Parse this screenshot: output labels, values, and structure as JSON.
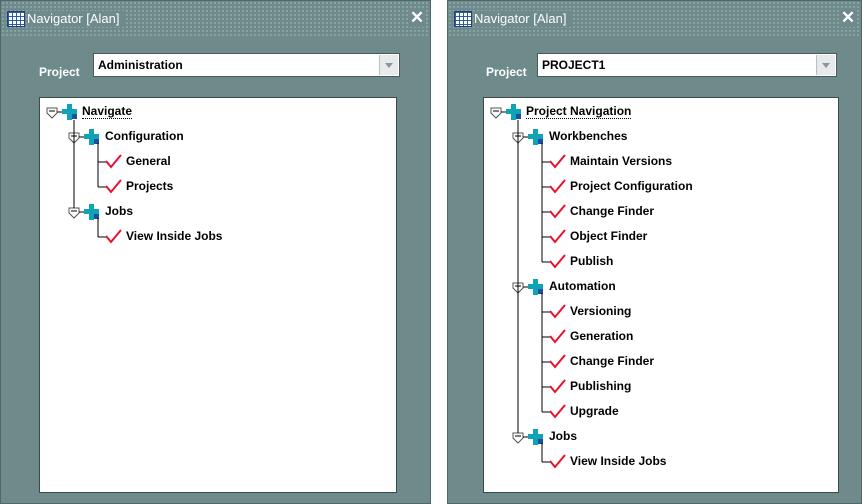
{
  "windows": [
    {
      "title": "Navigator [Alan]",
      "project_label": "Project",
      "project_value": "Administration",
      "tree": {
        "root": "Navigate",
        "nodes": [
          {
            "label": "Configuration",
            "children": [
              "General",
              "Projects"
            ]
          },
          {
            "label": "Jobs",
            "children": [
              "View Inside Jobs"
            ]
          }
        ]
      }
    },
    {
      "title": "Navigator [Alan]",
      "project_label": "Project",
      "project_value": "PROJECT1",
      "tree": {
        "root": "Project Navigation",
        "nodes": [
          {
            "label": "Workbenches",
            "children": [
              "Maintain Versions",
              "Project Configuration",
              "Change Finder",
              "Object Finder",
              "Publish"
            ]
          },
          {
            "label": "Automation",
            "children": [
              "Versioning",
              "Generation",
              "Change Finder",
              "Publishing",
              "Upgrade"
            ]
          },
          {
            "label": "Jobs",
            "children": [
              "View Inside Jobs"
            ]
          }
        ]
      }
    }
  ],
  "colors": {
    "window_bg": "#6f8a8b",
    "checkmark": "#e8102a",
    "folder_icon": "#0fa3b8"
  },
  "icons": {
    "app": "grid-table-icon",
    "close": "close-icon",
    "expanded": "collapse-node-icon",
    "folder": "cross-folder-icon",
    "leaf": "checkmark-icon"
  }
}
